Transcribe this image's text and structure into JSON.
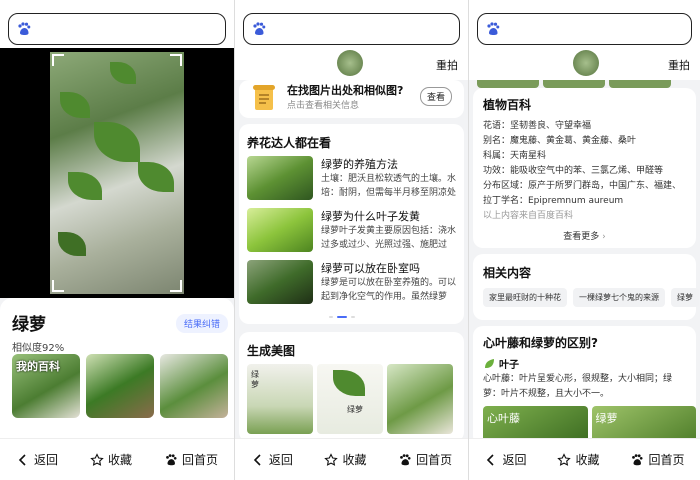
{
  "nav": {
    "back": "返回",
    "favorite": "收藏",
    "home": "回首页"
  },
  "panel1": {
    "plant_name": "绿萝",
    "similarity": "相似度92%",
    "fix_label": "结果纠错",
    "thumb_watermark": "我的百科"
  },
  "panel2": {
    "retake": "重拍",
    "info_title": "在找图片出处和相似图?",
    "info_sub": "点击查看相关信息",
    "check_label": "查看",
    "care_title": "养花达人都在看",
    "articles": [
      {
        "title": "绿萝的养殖方法",
        "text": "土壤：肥沃且松软透气的土壤。水培：耐阴，但需每半月移至阴凉处"
      },
      {
        "title": "绿萝为什么叶子发黄",
        "text": "绿萝叶子发黄主要原因包括：浇水过多或过少、光照过强、施肥过"
      },
      {
        "title": "绿萝可以放在卧室吗",
        "text": "绿萝是可以放在卧室养殖的。可以起到净化空气的作用。虽然绿萝"
      }
    ],
    "gen_title": "生成美图",
    "gen_label": "绿萝",
    "gen_vertical": "绿萝"
  },
  "panel3": {
    "retake": "重拍",
    "ency_title": "植物百科",
    "ency_lines": [
      "花语：坚韧善良、守望幸福",
      "别名：魔鬼藤、黄金葛、黄金藤、桑叶",
      "科属：天南星科",
      "功效：能吸收空气中的苯、三氯乙烯、甲醛等",
      "分布区域：原产于所罗门群岛，中国广东、福建、",
      "拉丁学名：Epipremnum aureum"
    ],
    "ency_source": "以上内容来自百度百科",
    "more": "查看更多",
    "related_title": "相关内容",
    "chips": [
      "家里最旺财的十种花",
      "一棵绿萝七个鬼的来源",
      "绿萝"
    ],
    "qa_title": "心叶藤和绿萝的区别?",
    "leaf_label": "叶子",
    "qa_text": "心叶藤：叶片呈爱心形，很规整，大小相同；绿萝：叶片不规整，且大小不一。",
    "qa_img_labels": [
      "心叶藤",
      "绿萝"
    ]
  },
  "colors": {
    "accent": "#4a6cf7",
    "leaf": "#4f8a2f",
    "background": "#f2f3f5"
  }
}
